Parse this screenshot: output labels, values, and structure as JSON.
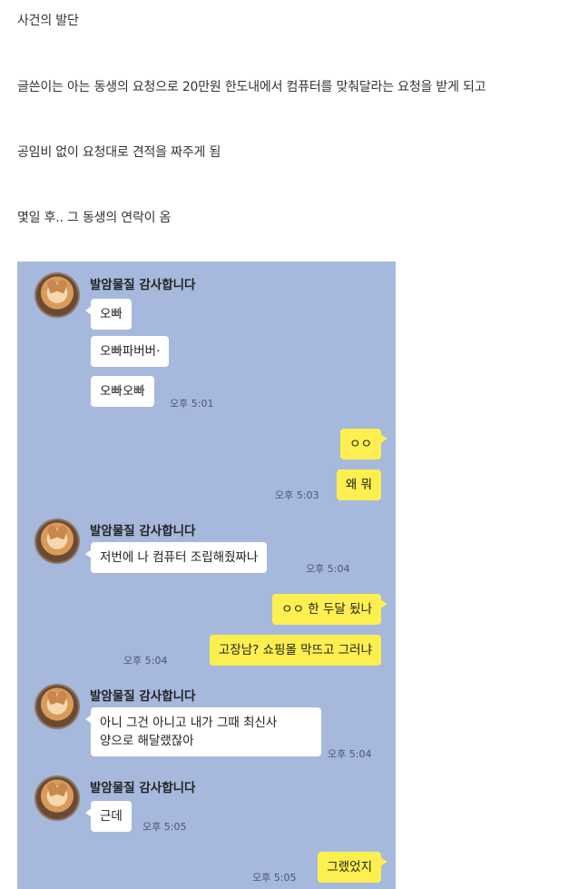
{
  "article": {
    "p1": "사건의 발단",
    "p2": "글쓴이는 아는 동생의 요청으로 20만원 한도내에서 컴퓨터를 맞춰달라는 요청을 받게 되고",
    "p3": "공임비 없이 요청대로 견적을 짜주게 됨",
    "p4": "몇일 후.. 그 동생의 연락이 옴"
  },
  "chat": {
    "contact_name": "발암물질 감사합니다",
    "colors": {
      "background": "#a6b9dc",
      "incoming": "#ffffff",
      "outgoing": "#fdef4f"
    },
    "messages": {
      "m1": "오빠",
      "m2": "오빠파버버·",
      "m3": "오빠오빠",
      "t1": "오후 5:01",
      "m4": "ㅇㅇ",
      "m5": "왜 뭐",
      "t2": "오후 5:03",
      "m6": "저번에 나 컴퓨터 조립해줬짜나",
      "t3": "오후 5:04",
      "m7": "ㅇㅇ 한 두달 됬나",
      "m8": "고장남? 쇼핑몰 막뜨고 그러냐",
      "t4": "오후 5:04",
      "m9a": "아니 그건 아니고 내가 그때 최신사",
      "m9b": "양으로 해달랬잖아",
      "t5": "오후 5:04",
      "m10": "근데",
      "t6": "오후 5:05",
      "m11": "그랬었지",
      "t7": "오후 5:05"
    }
  }
}
